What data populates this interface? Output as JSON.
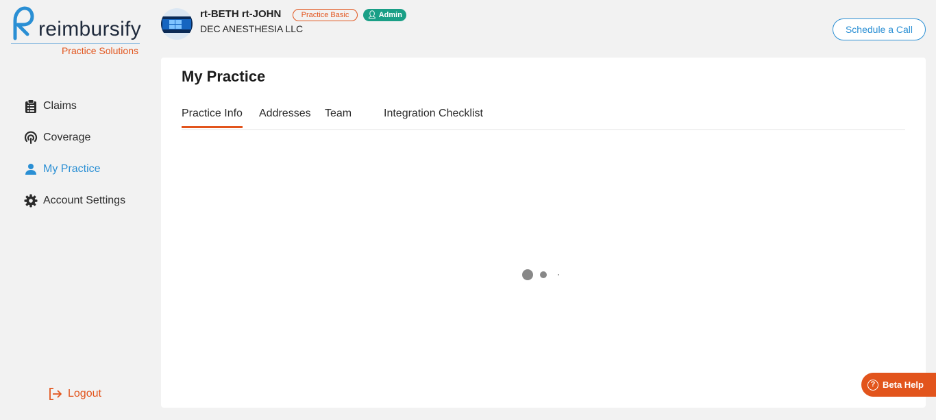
{
  "brand": {
    "name": "reimbursify",
    "subtitle": "Practice Solutions",
    "accent": "#e2541c",
    "primary": "#2a8fd4"
  },
  "sidebar": {
    "items": [
      {
        "label": "Claims",
        "icon": "clipboard-icon",
        "active": false
      },
      {
        "label": "Coverage",
        "icon": "signal-icon",
        "active": false
      },
      {
        "label": "My Practice",
        "icon": "user-icon",
        "active": true
      },
      {
        "label": "Account Settings",
        "icon": "gear-icon",
        "active": false
      }
    ],
    "logout_label": "Logout"
  },
  "header": {
    "user_name": "rt-BETH rt-JOHN",
    "plan_badge": "Practice Basic",
    "role_badge": "Admin",
    "practice_name": "DEC ANESTHESIA LLC",
    "schedule_label": "Schedule a Call"
  },
  "main": {
    "title": "My Practice",
    "tabs": [
      {
        "label": "Practice Info",
        "active": true
      },
      {
        "label": "Addresses",
        "active": false
      },
      {
        "label": "Team",
        "active": false
      },
      {
        "label": "Integration Checklist",
        "active": false
      }
    ]
  },
  "beta_help": {
    "label": "Beta Help",
    "icon": "question-circle-icon"
  }
}
